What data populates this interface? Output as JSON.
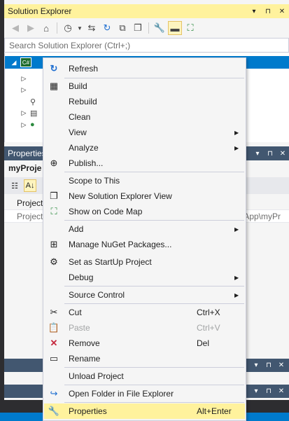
{
  "solution_explorer": {
    "title": "Solution Explorer",
    "pin_glyph": "▾",
    "autohide_glyph": "⊓",
    "close_glyph": "✕",
    "search_placeholder": "Search Solution Explorer (Ctrl+;)",
    "project_icon_text": "C#"
  },
  "properties": {
    "title": "Properties",
    "object_name": "myProje",
    "category_label": "Project",
    "row_label": "Project",
    "row_value": "rtApp\\myPr"
  },
  "context_menu": {
    "items": [
      {
        "label": "Refresh",
        "icon": "refresh-icon"
      },
      {
        "label": "Build",
        "icon": "build-icon"
      },
      {
        "label": "Rebuild",
        "icon": ""
      },
      {
        "label": "Clean",
        "icon": ""
      },
      {
        "label": "View",
        "icon": "",
        "submenu": true
      },
      {
        "label": "Analyze",
        "icon": "",
        "submenu": true
      },
      {
        "label": "Publish...",
        "icon": "globe-icon"
      },
      {
        "label": "Scope to This",
        "icon": ""
      },
      {
        "label": "New Solution Explorer View",
        "icon": "new-window-icon"
      },
      {
        "label": "Show on Code Map",
        "icon": "code-map-icon"
      },
      {
        "label": "Add",
        "icon": "",
        "submenu": true
      },
      {
        "label": "Manage NuGet Packages...",
        "icon": "nuget-icon"
      },
      {
        "label": "Set as StartUp Project",
        "icon": "gear-icon"
      },
      {
        "label": "Debug",
        "icon": "",
        "submenu": true
      },
      {
        "label": "Source Control",
        "icon": "",
        "submenu": true
      },
      {
        "label": "Cut",
        "icon": "cut-icon",
        "shortcut": "Ctrl+X"
      },
      {
        "label": "Paste",
        "icon": "paste-icon",
        "shortcut": "Ctrl+V",
        "disabled": true
      },
      {
        "label": "Remove",
        "icon": "remove-icon",
        "shortcut": "Del"
      },
      {
        "label": "Rename",
        "icon": "rename-icon"
      },
      {
        "label": "Unload Project",
        "icon": ""
      },
      {
        "label": "Open Folder in File Explorer",
        "icon": "open-folder-icon"
      },
      {
        "label": "Properties",
        "icon": "wrench-icon",
        "shortcut": "Alt+Enter",
        "highlighted": true
      }
    ]
  },
  "colors": {
    "title_active": "#fff29d",
    "accent": "#007acc",
    "panel_title": "#425770",
    "menu_hover": "#fff29d"
  }
}
